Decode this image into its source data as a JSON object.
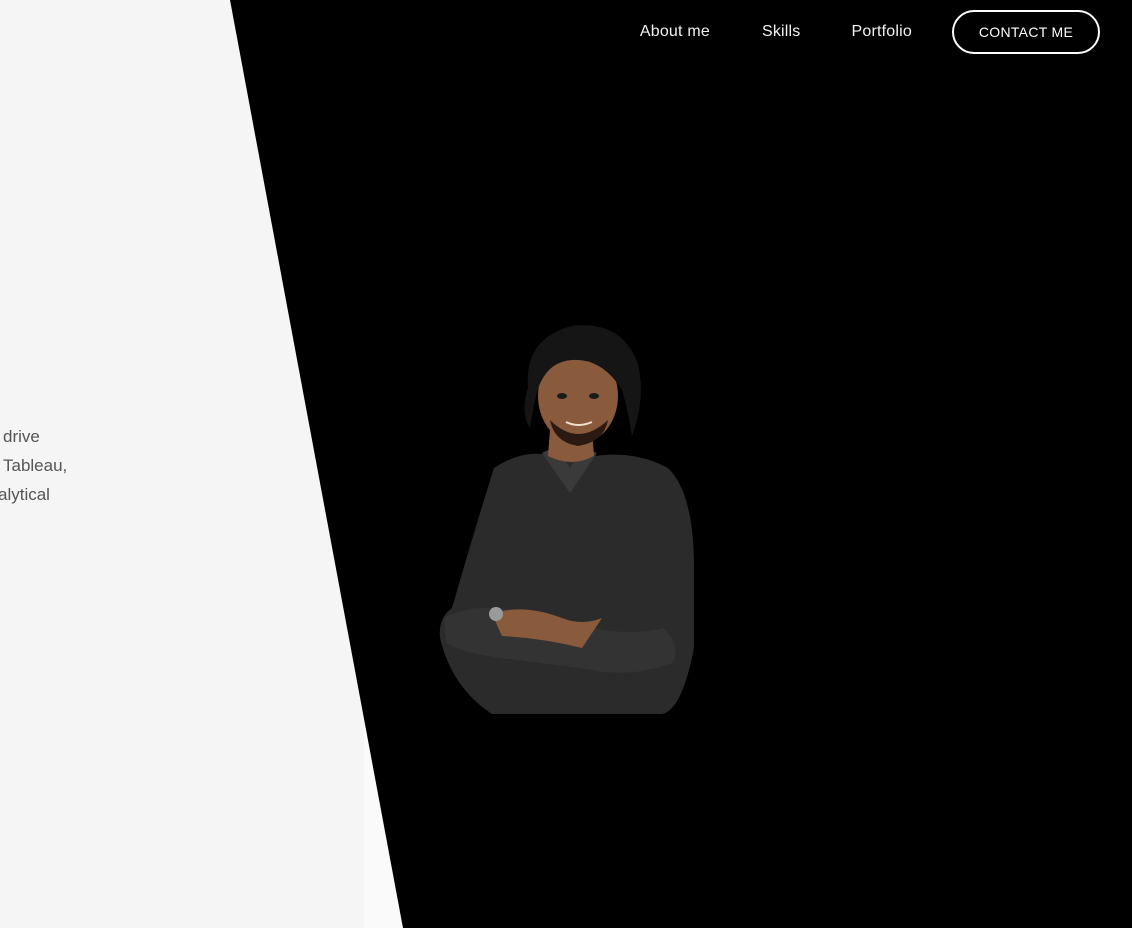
{
  "nav": {
    "items": [
      {
        "label": "About me"
      },
      {
        "label": "Skills"
      },
      {
        "label": "Portfolio"
      }
    ],
    "contact_label": "CONTACT ME"
  },
  "hero": {
    "intro_lines": [
      " drive",
      " Tableau,",
      "alytical"
    ],
    "portrait_icon": "person-portrait"
  },
  "colors": {
    "dark_background": "#000000",
    "light_background": "#f5f5f5",
    "nav_text": "#ffffff",
    "body_text": "#555555"
  }
}
